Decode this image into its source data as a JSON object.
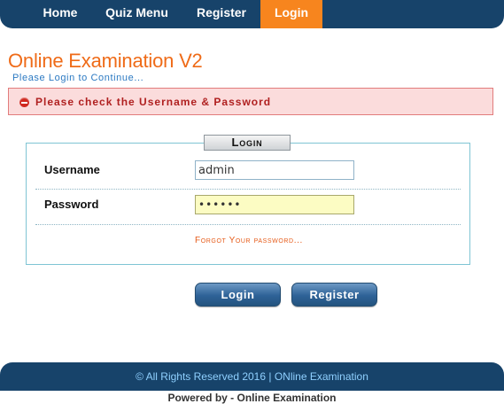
{
  "nav": {
    "items": [
      {
        "label": "Home"
      },
      {
        "label": "Quiz Menu"
      },
      {
        "label": "Register"
      },
      {
        "label": "Login",
        "active": true
      }
    ]
  },
  "header": {
    "title": "Online Examination V2",
    "subtitle": "Please Login to Continue..."
  },
  "error": {
    "icon": "error-icon",
    "message": "Please check the Username & Password"
  },
  "form": {
    "legend": "Login",
    "username_label": "Username",
    "username_value": "admin",
    "password_label": "Password",
    "password_value": "••••••",
    "forgot_link": "Forgot Your password..."
  },
  "buttons": {
    "login": "Login",
    "register": "Register"
  },
  "footer": {
    "copyright": "© All Rights Reserved 2016 | ONline Examination",
    "powered": "Powered by - Online Examination"
  },
  "colors": {
    "nav_bg": "#17436a",
    "active_tab": "#f7851e",
    "title": "#ef6b18",
    "error_bg": "#fbdcdc"
  }
}
